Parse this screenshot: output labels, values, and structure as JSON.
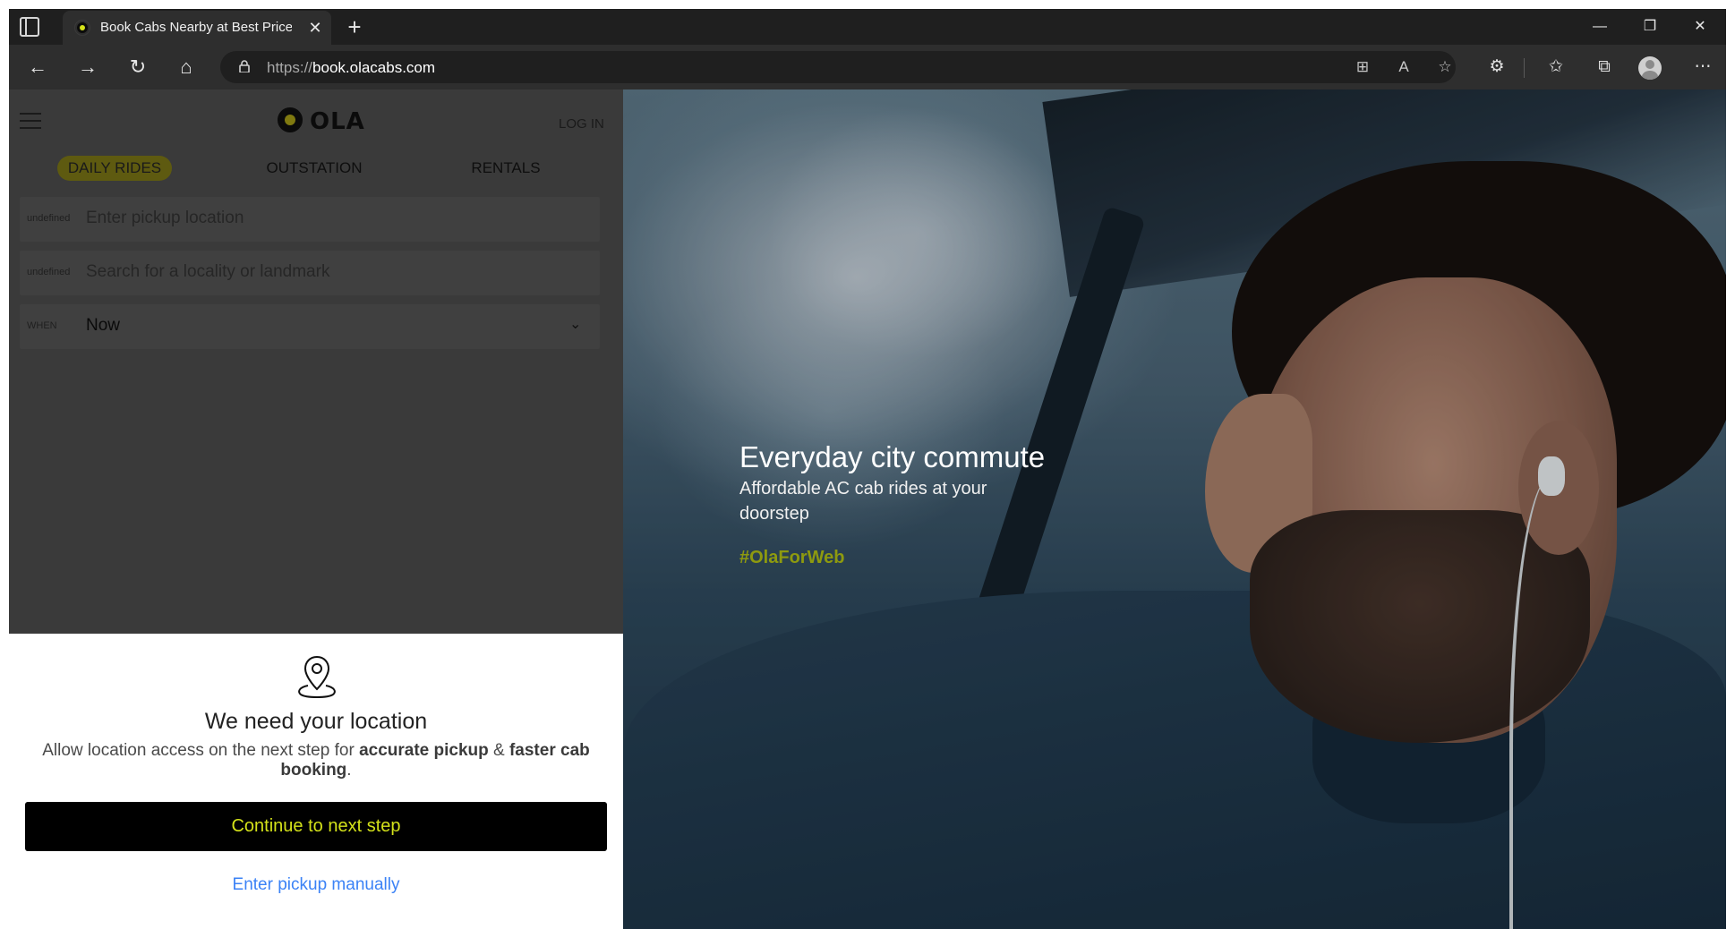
{
  "browser": {
    "tab_title": "Book Cabs Nearby at Best Price |",
    "url_protocol": "https://",
    "url_host": "book.olacabs.com",
    "icons": [
      "tab-actions-icon",
      "close-icon",
      "new-tab-icon",
      "minimize-icon",
      "restore-icon",
      "window-close-icon",
      "back-icon",
      "forward-icon",
      "refresh-icon",
      "home-icon",
      "lock-icon",
      "app-available-icon",
      "read-aloud-icon",
      "favorite-add-icon",
      "extensions-icon",
      "favorites-icon",
      "collections-icon",
      "profile-avatar",
      "more-icon"
    ]
  },
  "header": {
    "logo_text": "OLA",
    "login_label": "LOG IN"
  },
  "ride_tabs": [
    {
      "label": "DAILY RIDES",
      "active": true
    },
    {
      "label": "OUTSTATION",
      "active": false
    },
    {
      "label": "RENTALS",
      "active": false
    }
  ],
  "booking_form": {
    "pickup": {
      "tag": "undefined",
      "placeholder": "Enter pickup location"
    },
    "drop": {
      "tag": "undefined",
      "placeholder": "Search for a locality or landmark"
    },
    "when": {
      "tag": "WHEN",
      "value": "Now"
    }
  },
  "location_prompt": {
    "title": "We need your location",
    "desc_prefix": "Allow location access on the next step for ",
    "desc_bold_1": "accurate pickup",
    "desc_mid": " & ",
    "desc_bold_2": "faster cab booking",
    "desc_suffix": ".",
    "continue_label": "Continue to next step",
    "manual_label": "Enter pickup manually"
  },
  "hero": {
    "title": "Everyday city commute",
    "subtitle": "Affordable AC cab rides at your doorstep",
    "hashtag": "#OlaForWeb"
  },
  "colors": {
    "brand_accent": "#d4e21a",
    "link_blue": "#3b82f6",
    "button_black": "#000000"
  }
}
